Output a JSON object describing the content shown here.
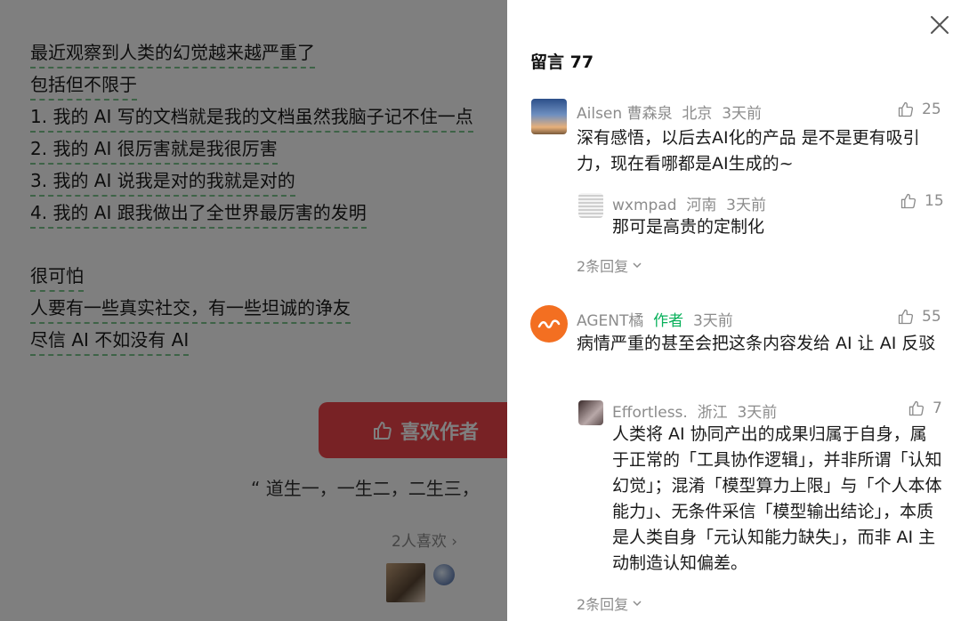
{
  "article": {
    "lines": [
      "最近观察到人类的幻觉越来越严重了",
      "包括但不限于",
      "1. 我的 AI 写的文档就是我的文档虽然我脑子记不住一点",
      "2. 我的 AI 很厉害就是我很厉害",
      "3. 我的 AI 说我是对的我就是对的",
      "4. 我的 AI 跟我做出了全世界最厉害的发明",
      "很可怕",
      "人要有一些真实社交，有一些坦诚的诤友",
      "尽信 AI 不如没有 AI"
    ],
    "like_author_label": "喜欢作者",
    "quote": "“ 道生一，一生二，二生三，",
    "likes_count": "2人喜欢",
    "likes_chevron": "›"
  },
  "comments_panel": {
    "title": "留言 77",
    "comments": [
      {
        "user": "Ailsen 曹森泉",
        "location": "北京",
        "time": "3天前",
        "likes": "25",
        "text": "深有感悟，以后去AI化的产品 是不是更有吸引力，现在看哪都是AI生成的~",
        "reply": {
          "user": "wxmpad",
          "location": "河南",
          "time": "3天前",
          "likes": "15",
          "text": "那可是高贵的定制化"
        },
        "replies_label": "2条回复"
      },
      {
        "user": "AGENT橘",
        "author_tag": "作者",
        "time": "3天前",
        "likes": "55",
        "text": "病情严重的甚至会把这条内容发给 AI 让 AI 反驳",
        "reply": {
          "user": "Effortless.",
          "location": "浙江",
          "time": "3天前",
          "likes": "7",
          "text": "人类将 AI 协同产出的成果归属于自身，属于正常的「工具协作逻辑」，并非所谓「认知幻觉」；混淆「模型算力上限」与「个人本体能力」、无条件采信「模型输出结论」，本质是人类自身「元认知能力缺失」，而非 AI 主动制造认知偏差。"
        },
        "replies_label": "2条回复"
      }
    ]
  },
  "colors": {
    "accent_green": "#07b05a",
    "like_button_red": "#f0444a",
    "underline_green": "#7cc68f"
  }
}
